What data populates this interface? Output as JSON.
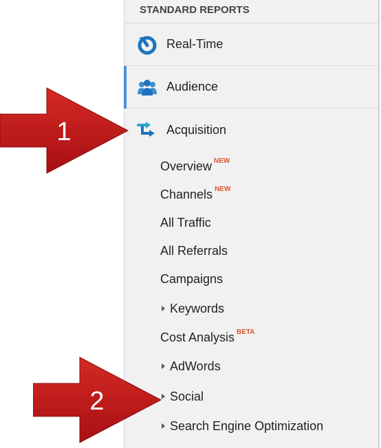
{
  "nav": {
    "section_header": "STANDARD REPORTS",
    "top_items": [
      {
        "label": "Real-Time",
        "icon": "realtime-icon"
      },
      {
        "label": "Audience",
        "icon": "audience-icon"
      },
      {
        "label": "Acquisition",
        "icon": "acquisition-icon"
      }
    ],
    "sub_items": [
      {
        "label": "Overview",
        "badge": "NEW"
      },
      {
        "label": "Channels",
        "badge": "NEW"
      },
      {
        "label": "All Traffic",
        "badge": ""
      },
      {
        "label": "All Referrals",
        "badge": ""
      },
      {
        "label": "Campaigns",
        "badge": ""
      },
      {
        "label": "Keywords",
        "badge": "",
        "expandable": true
      },
      {
        "label": "Cost Analysis",
        "badge": "BETA"
      },
      {
        "label": "AdWords",
        "badge": "",
        "expandable": true
      },
      {
        "label": "Social",
        "badge": "",
        "expandable": true
      },
      {
        "label": "Search Engine Optimization",
        "badge": "",
        "expandable": true
      }
    ]
  },
  "annotations": {
    "arrow1_label": "1",
    "arrow2_label": "2"
  },
  "colors": {
    "accent": "#4a90d9",
    "badge": "#e0562a",
    "arrow": "#c4161c"
  }
}
